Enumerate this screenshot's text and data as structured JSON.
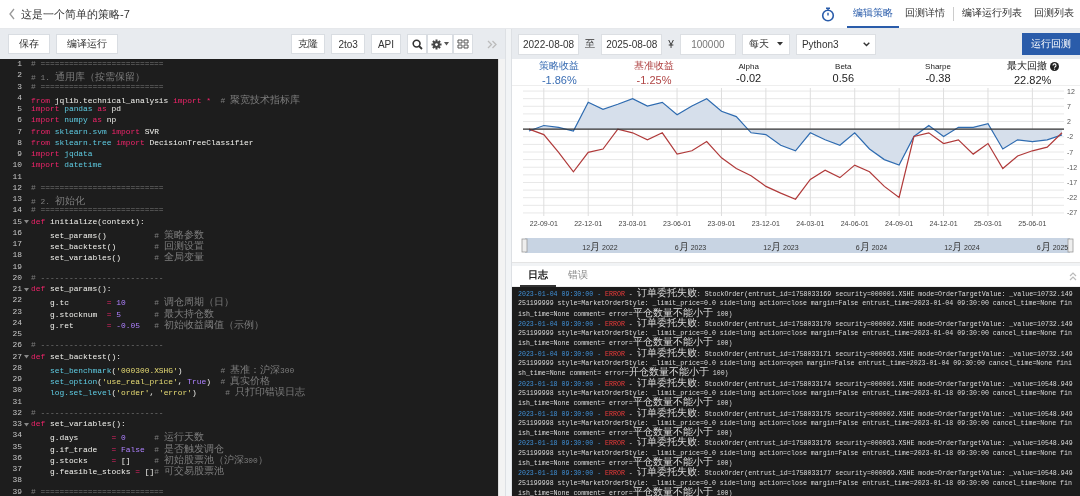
{
  "header": {
    "title": "这是一个简单的策略-7",
    "tabs": [
      {
        "label": "编辑策略",
        "selected": true,
        "separated": false
      },
      {
        "label": "回测详情",
        "selected": false,
        "separated": false
      },
      {
        "label": "编译运行列表",
        "selected": false,
        "separated": true
      },
      {
        "label": "回测列表",
        "selected": false,
        "separated": false
      }
    ]
  },
  "editor_toolbar": {
    "buttons": [
      "保 存",
      "编译运行"
    ],
    "tools": [
      "克隆",
      "2to3",
      "API"
    ]
  },
  "code": {
    "lines": [
      {
        "number": "1",
        "foldable": false,
        "tokens": [
          {
            "kind": "comment",
            "text": "# =========================="
          }
        ]
      },
      {
        "number": "2",
        "foldable": false,
        "tokens": [
          {
            "kind": "comment",
            "text": "# 1. 通用库（按需保留）"
          }
        ]
      },
      {
        "number": "3",
        "foldable": false,
        "tokens": [
          {
            "kind": "comment",
            "text": "# =========================="
          }
        ]
      },
      {
        "number": "4",
        "foldable": false,
        "tokens": [
          {
            "kind": "keyword",
            "text": "from"
          },
          {
            "kind": "plain",
            "text": " jqlib.technical_analysis "
          },
          {
            "kind": "keyword",
            "text": "import"
          },
          {
            "kind": "operator",
            "text": " *"
          },
          {
            "kind": "comment",
            "text": "  # 聚宽技术指标库"
          }
        ]
      },
      {
        "number": "5",
        "foldable": false,
        "tokens": [
          {
            "kind": "keyword",
            "text": "import"
          },
          {
            "kind": "module",
            "text": " pandas"
          },
          {
            "kind": "keyword",
            "text": " as"
          },
          {
            "kind": "plain",
            "text": " pd"
          }
        ]
      },
      {
        "number": "6",
        "foldable": false,
        "tokens": [
          {
            "kind": "keyword",
            "text": "import"
          },
          {
            "kind": "module",
            "text": " numpy"
          },
          {
            "kind": "keyword",
            "text": " as"
          },
          {
            "kind": "plain",
            "text": " np"
          }
        ]
      },
      {
        "number": "7",
        "foldable": false,
        "tokens": [
          {
            "kind": "keyword",
            "text": "from"
          },
          {
            "kind": "module",
            "text": " sklearn.svm"
          },
          {
            "kind": "keyword",
            "text": " import"
          },
          {
            "kind": "plain",
            "text": " SVR"
          }
        ]
      },
      {
        "number": "8",
        "foldable": false,
        "tokens": [
          {
            "kind": "keyword",
            "text": "from"
          },
          {
            "kind": "module",
            "text": " sklearn.tree"
          },
          {
            "kind": "keyword",
            "text": " import"
          },
          {
            "kind": "plain",
            "text": " DecisionTreeClassifier"
          }
        ]
      },
      {
        "number": "9",
        "foldable": false,
        "tokens": [
          {
            "kind": "keyword",
            "text": "import"
          },
          {
            "kind": "module",
            "text": " jqdata"
          }
        ]
      },
      {
        "number": "10",
        "foldable": false,
        "tokens": [
          {
            "kind": "keyword",
            "text": "import"
          },
          {
            "kind": "module",
            "text": " datetime"
          }
        ]
      },
      {
        "number": "11",
        "foldable": false
      },
      {
        "number": "12",
        "foldable": false,
        "tokens": [
          {
            "kind": "comment",
            "text": "# =========================="
          }
        ]
      },
      {
        "number": "13",
        "foldable": false,
        "tokens": [
          {
            "kind": "comment",
            "text": "# 2. 初始化"
          }
        ]
      },
      {
        "number": "14",
        "foldable": false,
        "tokens": [
          {
            "kind": "comment",
            "text": "# =========================="
          }
        ]
      },
      {
        "number": "15",
        "foldable": true,
        "tokens": [
          {
            "kind": "keyword",
            "text": "def"
          },
          {
            "kind": "plain",
            "text": " initialize(context):"
          }
        ]
      },
      {
        "number": "16",
        "foldable": false,
        "tokens": [
          {
            "kind": "plain",
            "text": "    set_params()          "
          },
          {
            "kind": "comment",
            "text": "# 策略参数"
          }
        ]
      },
      {
        "number": "17",
        "foldable": false,
        "tokens": [
          {
            "kind": "plain",
            "text": "    set_backtest()        "
          },
          {
            "kind": "comment",
            "text": "# 回测设置"
          }
        ]
      },
      {
        "number": "18",
        "foldable": false,
        "tokens": [
          {
            "kind": "plain",
            "text": "    set_variables()       "
          },
          {
            "kind": "comment",
            "text": "# 全局变量"
          }
        ]
      },
      {
        "number": "19",
        "foldable": false
      },
      {
        "number": "20",
        "foldable": false,
        "tokens": [
          {
            "kind": "comment",
            "text": "# --------------------------"
          }
        ]
      },
      {
        "number": "21",
        "foldable": true,
        "tokens": [
          {
            "kind": "keyword",
            "text": "def"
          },
          {
            "kind": "plain",
            "text": " set_params():"
          }
        ]
      },
      {
        "number": "22",
        "foldable": false,
        "tokens": [
          {
            "kind": "plain",
            "text": "    g.tc        "
          },
          {
            "kind": "operator",
            "text": "="
          },
          {
            "kind": "number",
            "text": " 10"
          },
          {
            "kind": "comment",
            "text": "      # 调仓周期（日）"
          }
        ]
      },
      {
        "number": "23",
        "foldable": false,
        "tokens": [
          {
            "kind": "plain",
            "text": "    g.stocknum  "
          },
          {
            "kind": "operator",
            "text": "="
          },
          {
            "kind": "number",
            "text": " 5"
          },
          {
            "kind": "comment",
            "text": "       # 最大持仓数"
          }
        ]
      },
      {
        "number": "24",
        "foldable": false,
        "tokens": [
          {
            "kind": "plain",
            "text": "    g.ret       "
          },
          {
            "kind": "operator",
            "text": "="
          },
          {
            "kind": "number",
            "text": " -0.05"
          },
          {
            "kind": "comment",
            "text": "   # 初始收益阈值（示例）"
          }
        ]
      },
      {
        "number": "25",
        "foldable": false
      },
      {
        "number": "26",
        "foldable": false,
        "tokens": [
          {
            "kind": "comment",
            "text": "# --------------------------"
          }
        ]
      },
      {
        "number": "27",
        "foldable": true,
        "tokens": [
          {
            "kind": "keyword",
            "text": "def"
          },
          {
            "kind": "plain",
            "text": " set_backtest():"
          }
        ]
      },
      {
        "number": "28",
        "foldable": false,
        "tokens": [
          {
            "kind": "function",
            "text": "    set_benchmark"
          },
          {
            "kind": "plain",
            "text": "("
          },
          {
            "kind": "string",
            "text": "'000300.XSHG'"
          },
          {
            "kind": "plain",
            "text": ")"
          },
          {
            "kind": "comment",
            "text": "        # 基准：沪深300"
          }
        ]
      },
      {
        "number": "29",
        "foldable": false,
        "tokens": [
          {
            "kind": "function",
            "text": "    set_option"
          },
          {
            "kind": "plain",
            "text": "("
          },
          {
            "kind": "string",
            "text": "'use_real_price'"
          },
          {
            "kind": "plain",
            "text": ", "
          },
          {
            "kind": "number",
            "text": "True"
          },
          {
            "kind": "plain",
            "text": ")"
          },
          {
            "kind": "comment",
            "text": "  # 真实价格"
          }
        ]
      },
      {
        "number": "30",
        "foldable": false,
        "tokens": [
          {
            "kind": "function",
            "text": "    log.set_level"
          },
          {
            "kind": "plain",
            "text": "("
          },
          {
            "kind": "string",
            "text": "'order'"
          },
          {
            "kind": "plain",
            "text": ", "
          },
          {
            "kind": "string",
            "text": "'error'"
          },
          {
            "kind": "plain",
            "text": ")"
          },
          {
            "kind": "comment",
            "text": "      # 只打印错误日志"
          }
        ]
      },
      {
        "number": "31",
        "foldable": false
      },
      {
        "number": "32",
        "foldable": false,
        "tokens": [
          {
            "kind": "comment",
            "text": "# --------------------------"
          }
        ]
      },
      {
        "number": "33",
        "foldable": true,
        "tokens": [
          {
            "kind": "keyword",
            "text": "def"
          },
          {
            "kind": "plain",
            "text": " set_variables():"
          }
        ]
      },
      {
        "number": "34",
        "foldable": false,
        "tokens": [
          {
            "kind": "plain",
            "text": "    g.days       "
          },
          {
            "kind": "operator",
            "text": "="
          },
          {
            "kind": "number",
            "text": " 0"
          },
          {
            "kind": "comment",
            "text": "      # 运行天数"
          }
        ]
      },
      {
        "number": "35",
        "foldable": false,
        "tokens": [
          {
            "kind": "plain",
            "text": "    g.if_trade   "
          },
          {
            "kind": "operator",
            "text": "="
          },
          {
            "kind": "number",
            "text": " False"
          },
          {
            "kind": "comment",
            "text": "  # 是否触发调仓"
          }
        ]
      },
      {
        "number": "36",
        "foldable": false,
        "tokens": [
          {
            "kind": "plain",
            "text": "    g.stocks     "
          },
          {
            "kind": "operator",
            "text": "="
          },
          {
            "kind": "plain",
            "text": " []"
          },
          {
            "kind": "comment",
            "text": "     # 初始股票池（沪深300）"
          }
        ]
      },
      {
        "number": "37",
        "foldable": false,
        "tokens": [
          {
            "kind": "plain",
            "text": "    g.feasible_stocks "
          },
          {
            "kind": "operator",
            "text": "="
          },
          {
            "kind": "plain",
            "text": " []"
          },
          {
            "kind": "comment",
            "text": "# 可交易股票池"
          }
        ]
      },
      {
        "number": "38",
        "foldable": false
      },
      {
        "number": "39",
        "foldable": false,
        "tokens": [
          {
            "kind": "comment",
            "text": "# =========================="
          }
        ]
      }
    ]
  },
  "backtest_form": {
    "start_date": "2022-08-08",
    "range_separator": "至",
    "end_date": "2025-08-08",
    "currency_symbol": "¥",
    "capital": "100000",
    "frequency": "每天",
    "language": "Python3",
    "run_button": "运行回测"
  },
  "metrics": [
    {
      "label": "策略收益",
      "value": "-1.86%",
      "color": "#3a6db3",
      "help": false
    },
    {
      "label": "基准收益",
      "value": "-1.25%",
      "color": "#b04545",
      "help": false
    },
    {
      "label": "Alpha",
      "value": "-0.02",
      "help": false
    },
    {
      "label": "Beta",
      "value": "0.56",
      "help": false
    },
    {
      "label": "Sharpe",
      "value": "-0.38",
      "help": false
    },
    {
      "label": "最大回撤",
      "value": "22.82%",
      "help": true
    }
  ],
  "chart": {
    "navigator_labels": [
      "12月 2022",
      "6月 2023",
      "12月 2023",
      "6月 2024",
      "12月 2024",
      "6月 2025"
    ],
    "chart_data": {
      "type": "line",
      "grid": true,
      "categories": [
        null,
        "22-09-01",
        null,
        null,
        "22-12-01",
        null,
        null,
        "23-03-01",
        null,
        null,
        "23-06-01",
        null,
        null,
        "23-09-01",
        null,
        null,
        "23-12-01",
        null,
        null,
        "24-03-01",
        null,
        null,
        "24-06-01",
        null,
        null,
        "24-09-01",
        null,
        null,
        "24-12-01",
        null,
        null,
        "25-03-01",
        null,
        null,
        "25-06-01",
        null,
        null
      ],
      "series": [
        {
          "color": "#2e6bb0",
          "values": [
            -0.6,
            1.2,
            0.6,
            -0.6,
            8.8,
            6.5,
            8.2,
            10,
            7.6,
            8.8,
            4.7,
            7.6,
            10,
            5.9,
            4.1,
            -1.2,
            -1.8,
            -5.3,
            -7.1,
            -1.2,
            -3.5,
            -5.3,
            -1.2,
            -6.5,
            -10,
            -11.8,
            -2.4,
            1.2,
            -2.4,
            0.6,
            0.6,
            1.8,
            -6.5,
            -3.5,
            -4.1,
            -3.5,
            -1.9
          ]
        },
        {
          "color": "#b03a3a",
          "values": [
            0,
            -1.8,
            -7.6,
            -14,
            -7.6,
            -6.5,
            0,
            -1.2,
            -3.5,
            -1.2,
            -8.2,
            -7.1,
            -4.1,
            -9.4,
            -12.9,
            -15.3,
            -18.8,
            -21,
            -23,
            -16.5,
            -13.5,
            -15.9,
            -11.8,
            -14,
            -18.8,
            -22.4,
            -2.4,
            -1.2,
            -4.7,
            -3.5,
            -8.2,
            -4.7,
            -12.9,
            -8.8,
            -7.1,
            -5.9,
            -1.2
          ]
        }
      ],
      "ylim": [
        -28.5,
        13.5
      ],
      "yticks": [
        {
          "value": 12.5,
          "label": "12"
        },
        {
          "value": 7.5,
          "label": "7"
        },
        {
          "value": 2.5,
          "label": "2"
        },
        {
          "value": -2.5,
          "label": "-2"
        },
        {
          "value": -7.5,
          "label": "-7"
        },
        {
          "value": -12.5,
          "label": "-12"
        },
        {
          "value": -17.5,
          "label": "-17"
        },
        {
          "value": -22.5,
          "label": "-22"
        },
        {
          "value": -27.5,
          "label": "-27"
        }
      ]
    }
  },
  "log": {
    "tabs": [
      {
        "label": "日志",
        "selected": true
      },
      {
        "label": "错误",
        "selected": false
      }
    ],
    "entries": [
      {
        "kind": "error",
        "time": "2023-01-04 09:30:00 -",
        "level": "ERROR",
        "message": "- 订单委托失败: StockOrder(entrust_id=1758033169 security=000001.XSHE mode=OrderTargetValue: _value=10732.149251199999 style=MarketOrderStyle: _limit_price=0.0 side=long action=close margin=False entrust_time=2023-01-04 09:30:00 cancel_time=None finish_time=None comment= error=平仓数量不能小于 100)"
      },
      {
        "kind": "error",
        "time": "2023-01-04 09:30:00 -",
        "level": "ERROR",
        "message": "- 订单委托失败: StockOrder(entrust_id=1758033170 security=000002.XSHE mode=OrderTargetValue: _value=10732.149251199999 style=MarketOrderStyle: _limit_price=0.0 side=long action=close margin=False entrust_time=2023-01-04 09:30:00 cancel_time=None finish_time=None comment= error=平仓数量不能小于 100)"
      },
      {
        "kind": "error",
        "time": "2023-01-04 09:30:00 -",
        "level": "ERROR",
        "message": "- 订单委托失败: StockOrder(entrust_id=1758033171 security=000063.XSHE mode=OrderTargetValue: _value=10732.149251199999 style=MarketOrderStyle: _limit_price=0.0 side=long action=open margin=False entrust_time=2023-01-04 09:30:00 cancel_time=None finish_time=None comment= error=开仓数量不能小于 100)"
      },
      {
        "kind": "error",
        "time": "2023-01-18 09:30:00 -",
        "level": "ERROR",
        "message": "- 订单委托失败: StockOrder(entrust_id=1758033174 security=000001.XSHE mode=OrderTargetValue: _value=10548.949251199998 style=MarketOrderStyle: _limit_price=0.0 side=long action=close margin=False entrust_time=2023-01-18 09:30:00 cancel_time=None finish_time=None comment= error=平仓数量不能小于 100)"
      },
      {
        "kind": "error",
        "time": "2023-01-18 09:30:00 -",
        "level": "ERROR",
        "message": "- 订单委托失败: StockOrder(entrust_id=1758033175 security=000002.XSHE mode=OrderTargetValue: _value=10548.949251199998 style=MarketOrderStyle: _limit_price=0.0 side=long action=close margin=False entrust_time=2023-01-18 09:30:00 cancel_time=None finish_time=None comment= error=平仓数量不能小于 100)"
      },
      {
        "kind": "error",
        "time": "2023-01-18 09:30:00 -",
        "level": "ERROR",
        "message": "- 订单委托失败: StockOrder(entrust_id=1758033176 security=000063.XSHE mode=OrderTargetValue: _value=10548.949251199998 style=MarketOrderStyle: _limit_price=0.0 side=long action=close margin=False entrust_time=2023-01-18 09:30:00 cancel_time=None finish_time=None comment= error=平仓数量不能小于 100)"
      },
      {
        "kind": "error",
        "time": "2023-01-18 09:30:00 -",
        "level": "ERROR",
        "message": "- 订单委托失败: StockOrder(entrust_id=1758033177 security=000069.XSHE mode=OrderTargetValue: _value=10548.949251199998 style=MarketOrderStyle: _limit_price=0.0 side=long action=close margin=False entrust_time=2023-01-18 09:30:00 cancel_time=None finish_time=None comment= error=平仓数量不能小于 100)"
      }
    ]
  }
}
